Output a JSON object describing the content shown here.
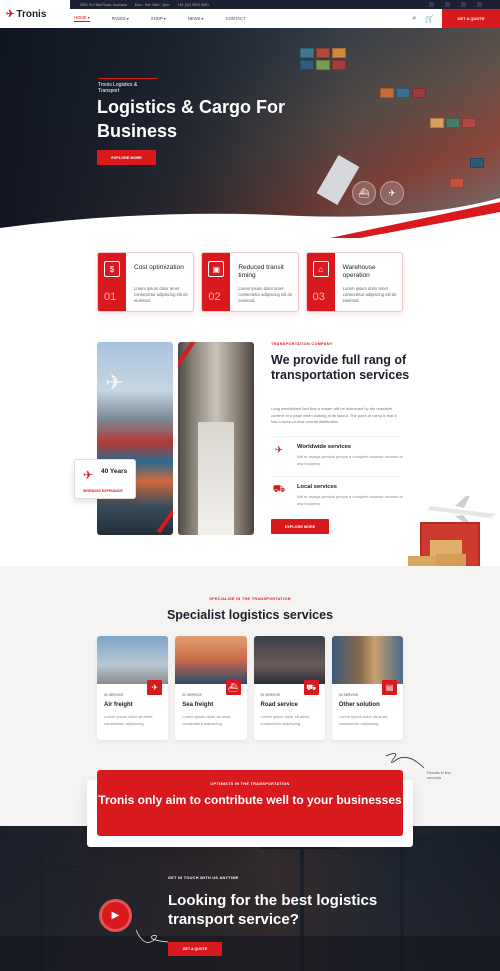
{
  "brand": {
    "name": "Tronis",
    "accent": "#d81a1f",
    "dark": "#1d2030"
  },
  "topbar": {
    "address": "3891 St Kilda Road, Australia",
    "hours": "Mon - Sat: 9am - 5pm",
    "phone": "+61 (0)3 9510 8961"
  },
  "nav": {
    "items": [
      "HOME",
      "PAGES",
      "SHOP",
      "NEWS",
      "CONTACT"
    ],
    "quote": "GET A QUOTE"
  },
  "hero": {
    "sub": "Tronis Logistics & Transport",
    "title": "Logistics & Cargo For Business",
    "button": "EXPLORE MORE"
  },
  "features": [
    {
      "num": "01",
      "title": "Cost optimization",
      "text": "Lorem ipsum dolor amet consectetur adipiscing elit do eiusmod.",
      "icon": "money-icon"
    },
    {
      "num": "02",
      "title": "Reduced transit timing",
      "text": "Lorem ipsum dolor amet consectetur adipiscing elit do eiusmod.",
      "icon": "box-icon"
    },
    {
      "num": "03",
      "title": "Warehouse operation",
      "text": "Lorem ipsum dolor amet consectetur adipiscing elit do eiusmod.",
      "icon": "warehouse-icon"
    }
  ],
  "about": {
    "tag": "TRANSPORTATION COMPANY",
    "title": "We provide full rang of transportation services",
    "text": "Long established fact that a reader will be distracted by the readable content of a page when looking at its layout. The point of using is that it has a more-or-less normal distribution.",
    "services": [
      {
        "title": "Worldwide services",
        "text": "We're always provide people a complete solution focused of any business."
      },
      {
        "title": "Local services",
        "text": "We're always provide people a complete solution focused of any business."
      }
    ],
    "button": "EXPLORE MORE",
    "experience": {
      "years": "40 Years",
      "label": "WORKING EXPRIANCE"
    }
  },
  "specialist": {
    "tag": "SPECIALISE IN THE TRANSPORTATION",
    "title": "Specialist logistics services",
    "cards": [
      {
        "num": "01 SERVICE",
        "title": "Air freight",
        "text": "Lorem ipsum dolor sit amet, consectetur adipiscing"
      },
      {
        "num": "02 SERVICE",
        "title": "Sea freight",
        "text": "Lorem ipsum dolor sit amet, consectetur adipiscing"
      },
      {
        "num": "03 SERVICE",
        "title": "Road service",
        "text": "Lorem ipsum dolor sit amet, consectetur adipiscing"
      },
      {
        "num": "04 SERVICE",
        "title": "Other solution",
        "text": "Lorem ipsum dolor sit amet, consectetur adipiscing"
      }
    ],
    "note": "Results in few seconds"
  },
  "cta": {
    "tag": "OPTIMISTS IN THE TRANSPORTATION",
    "title": "Tronis only aim to contribute well to your businesses"
  },
  "contact": {
    "tag": "GET IN TOUCH WITH US ANYTIME",
    "title": "Looking for the best logistics transport service?",
    "button": "GET A QUOTE"
  }
}
